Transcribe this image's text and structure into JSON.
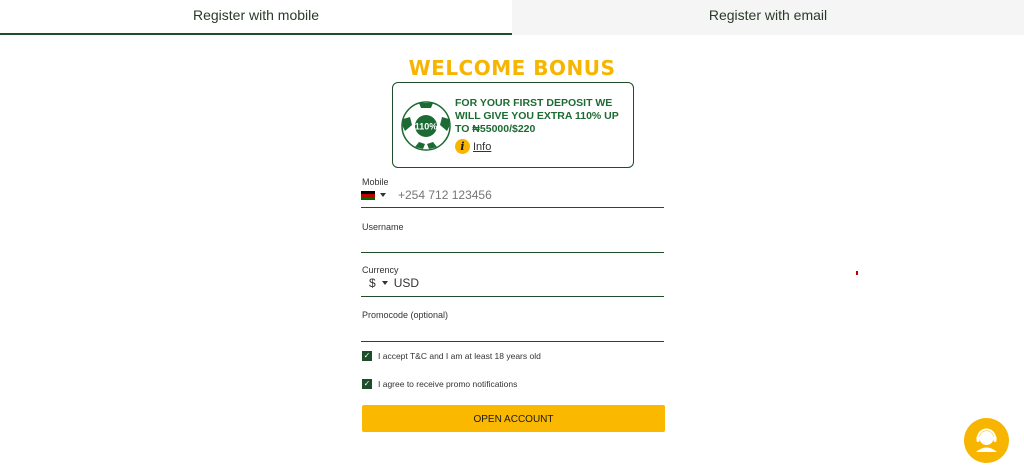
{
  "tabs": [
    {
      "label": "Register with mobile",
      "active": true
    },
    {
      "label": "Register with email",
      "active": false
    }
  ],
  "bonus": {
    "title": "WELCOME BONUS",
    "ball_text": "110%",
    "text": "FOR YOUR FIRST DEPOSIT WE WILL GIVE YOU EXTRA 110% UP TO ₦55000/$220",
    "info_label": "Info"
  },
  "form": {
    "mobile": {
      "label": "Mobile",
      "country": "Kenya",
      "placeholder": "+254 712 123456",
      "value": ""
    },
    "username": {
      "label": "Username",
      "value": ""
    },
    "currency": {
      "label": "Currency",
      "symbol": "$",
      "value": "USD"
    },
    "promocode": {
      "label": "Promocode (optional)",
      "value": ""
    },
    "checkboxes": [
      {
        "label": "I accept T&C and I am at least 18 years old",
        "checked": true
      },
      {
        "label": "I agree to receive promo notifications",
        "checked": true
      }
    ],
    "submit_label": "OPEN ACCOUNT"
  },
  "colors": {
    "brand_green": "#1d4d2a",
    "accent_yellow": "#f7b500"
  },
  "icons": {
    "support": "support-agent-icon",
    "info": "info-icon"
  }
}
